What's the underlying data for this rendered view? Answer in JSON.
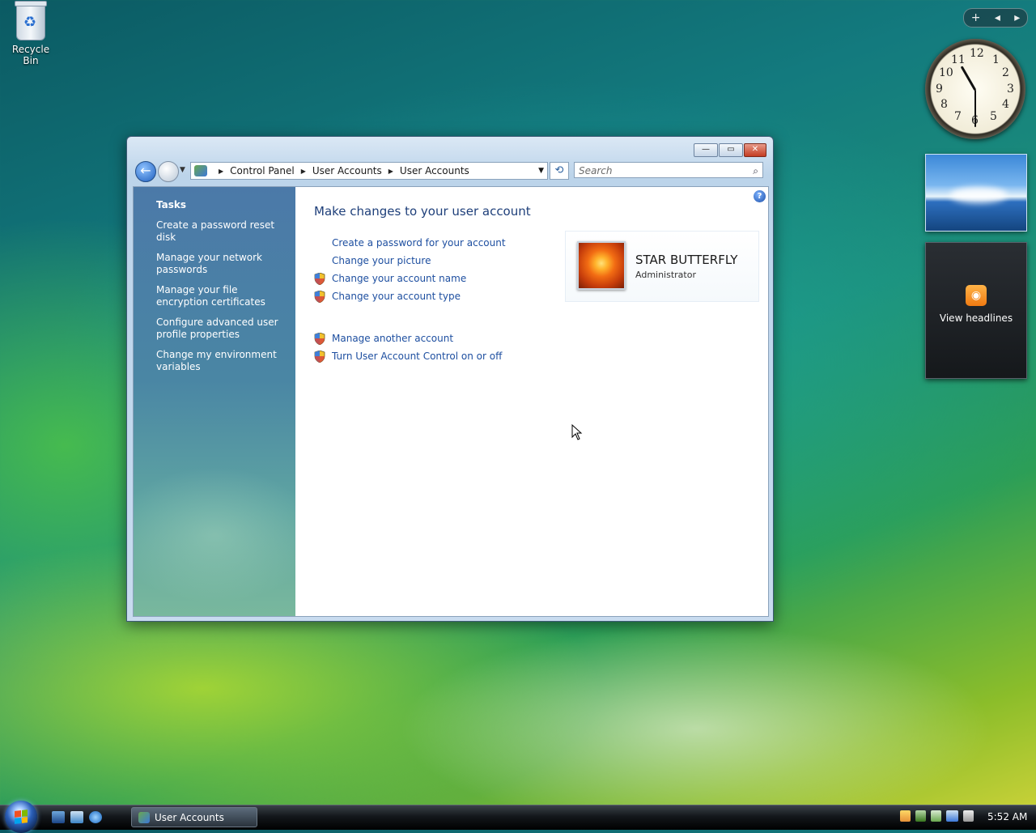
{
  "desktop": {
    "recycle_bin_label": "Recycle Bin"
  },
  "gadgets": {
    "add_symbol": "+",
    "clock_numbers": [
      "12",
      "1",
      "2",
      "3",
      "4",
      "5",
      "6",
      "7",
      "8",
      "9",
      "10",
      "11"
    ],
    "feed_label": "View headlines"
  },
  "window": {
    "title": "User Accounts",
    "breadcrumb": [
      "Control Panel",
      "User Accounts",
      "User Accounts"
    ],
    "search_placeholder": "Search",
    "tasks": {
      "title": "Tasks",
      "items": [
        "Create a password reset disk",
        "Manage your network passwords",
        "Manage your file encryption certificates",
        "Configure advanced user profile properties",
        "Change my environment variables"
      ]
    },
    "main": {
      "heading": "Make changes to your user account",
      "links_group1": [
        {
          "label": "Create a password for your account",
          "shield": false
        },
        {
          "label": "Change your picture",
          "shield": false
        },
        {
          "label": "Change your account name",
          "shield": true
        },
        {
          "label": "Change your account type",
          "shield": true
        }
      ],
      "links_group2": [
        {
          "label": "Manage another account",
          "shield": true
        },
        {
          "label": "Turn User Account Control on or off",
          "shield": true
        }
      ],
      "account": {
        "name": "STAR BUTTERFLY",
        "role": "Administrator"
      }
    }
  },
  "taskbar": {
    "active_item": "User Accounts",
    "time": "5:52 AM"
  },
  "colors": {
    "link": "#1e4fa0",
    "heading": "#1e3f7a",
    "taskpane_top": "#4b79a8"
  }
}
